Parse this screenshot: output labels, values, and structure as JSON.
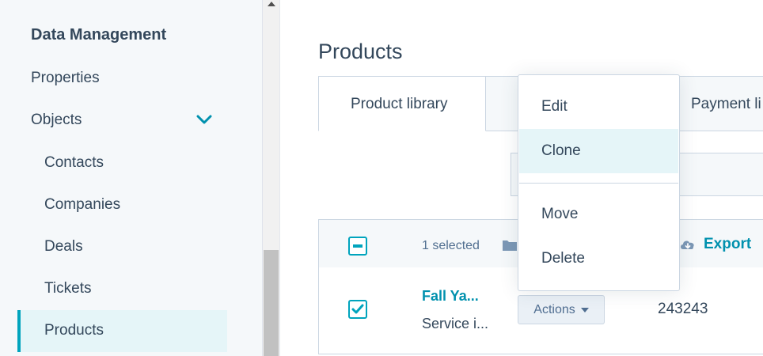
{
  "sidebar": {
    "section_title": "Data Management",
    "items": [
      {
        "label": "Properties"
      },
      {
        "label": "Objects"
      },
      {
        "label": "Contacts"
      },
      {
        "label": "Companies"
      },
      {
        "label": "Deals"
      },
      {
        "label": "Tickets"
      },
      {
        "label": "Products"
      }
    ],
    "active_item": "Products",
    "accent_color": "#00a4bd"
  },
  "main": {
    "page_title": "Products",
    "tabs": [
      {
        "label": "Product library"
      },
      {
        "label": ""
      },
      {
        "label": "Payment li"
      }
    ],
    "table": {
      "selected_count": "1 selected",
      "export_label": "Export",
      "rows": [
        {
          "name": "Fall Ya...",
          "description": "Service i...",
          "actions_label": "Actions",
          "sku": "243243"
        }
      ]
    }
  },
  "dropdown": {
    "items": [
      {
        "label": "Edit"
      },
      {
        "label": "Clone"
      },
      {
        "label": "Move"
      },
      {
        "label": "Delete"
      }
    ],
    "hovered_item": "Clone"
  }
}
